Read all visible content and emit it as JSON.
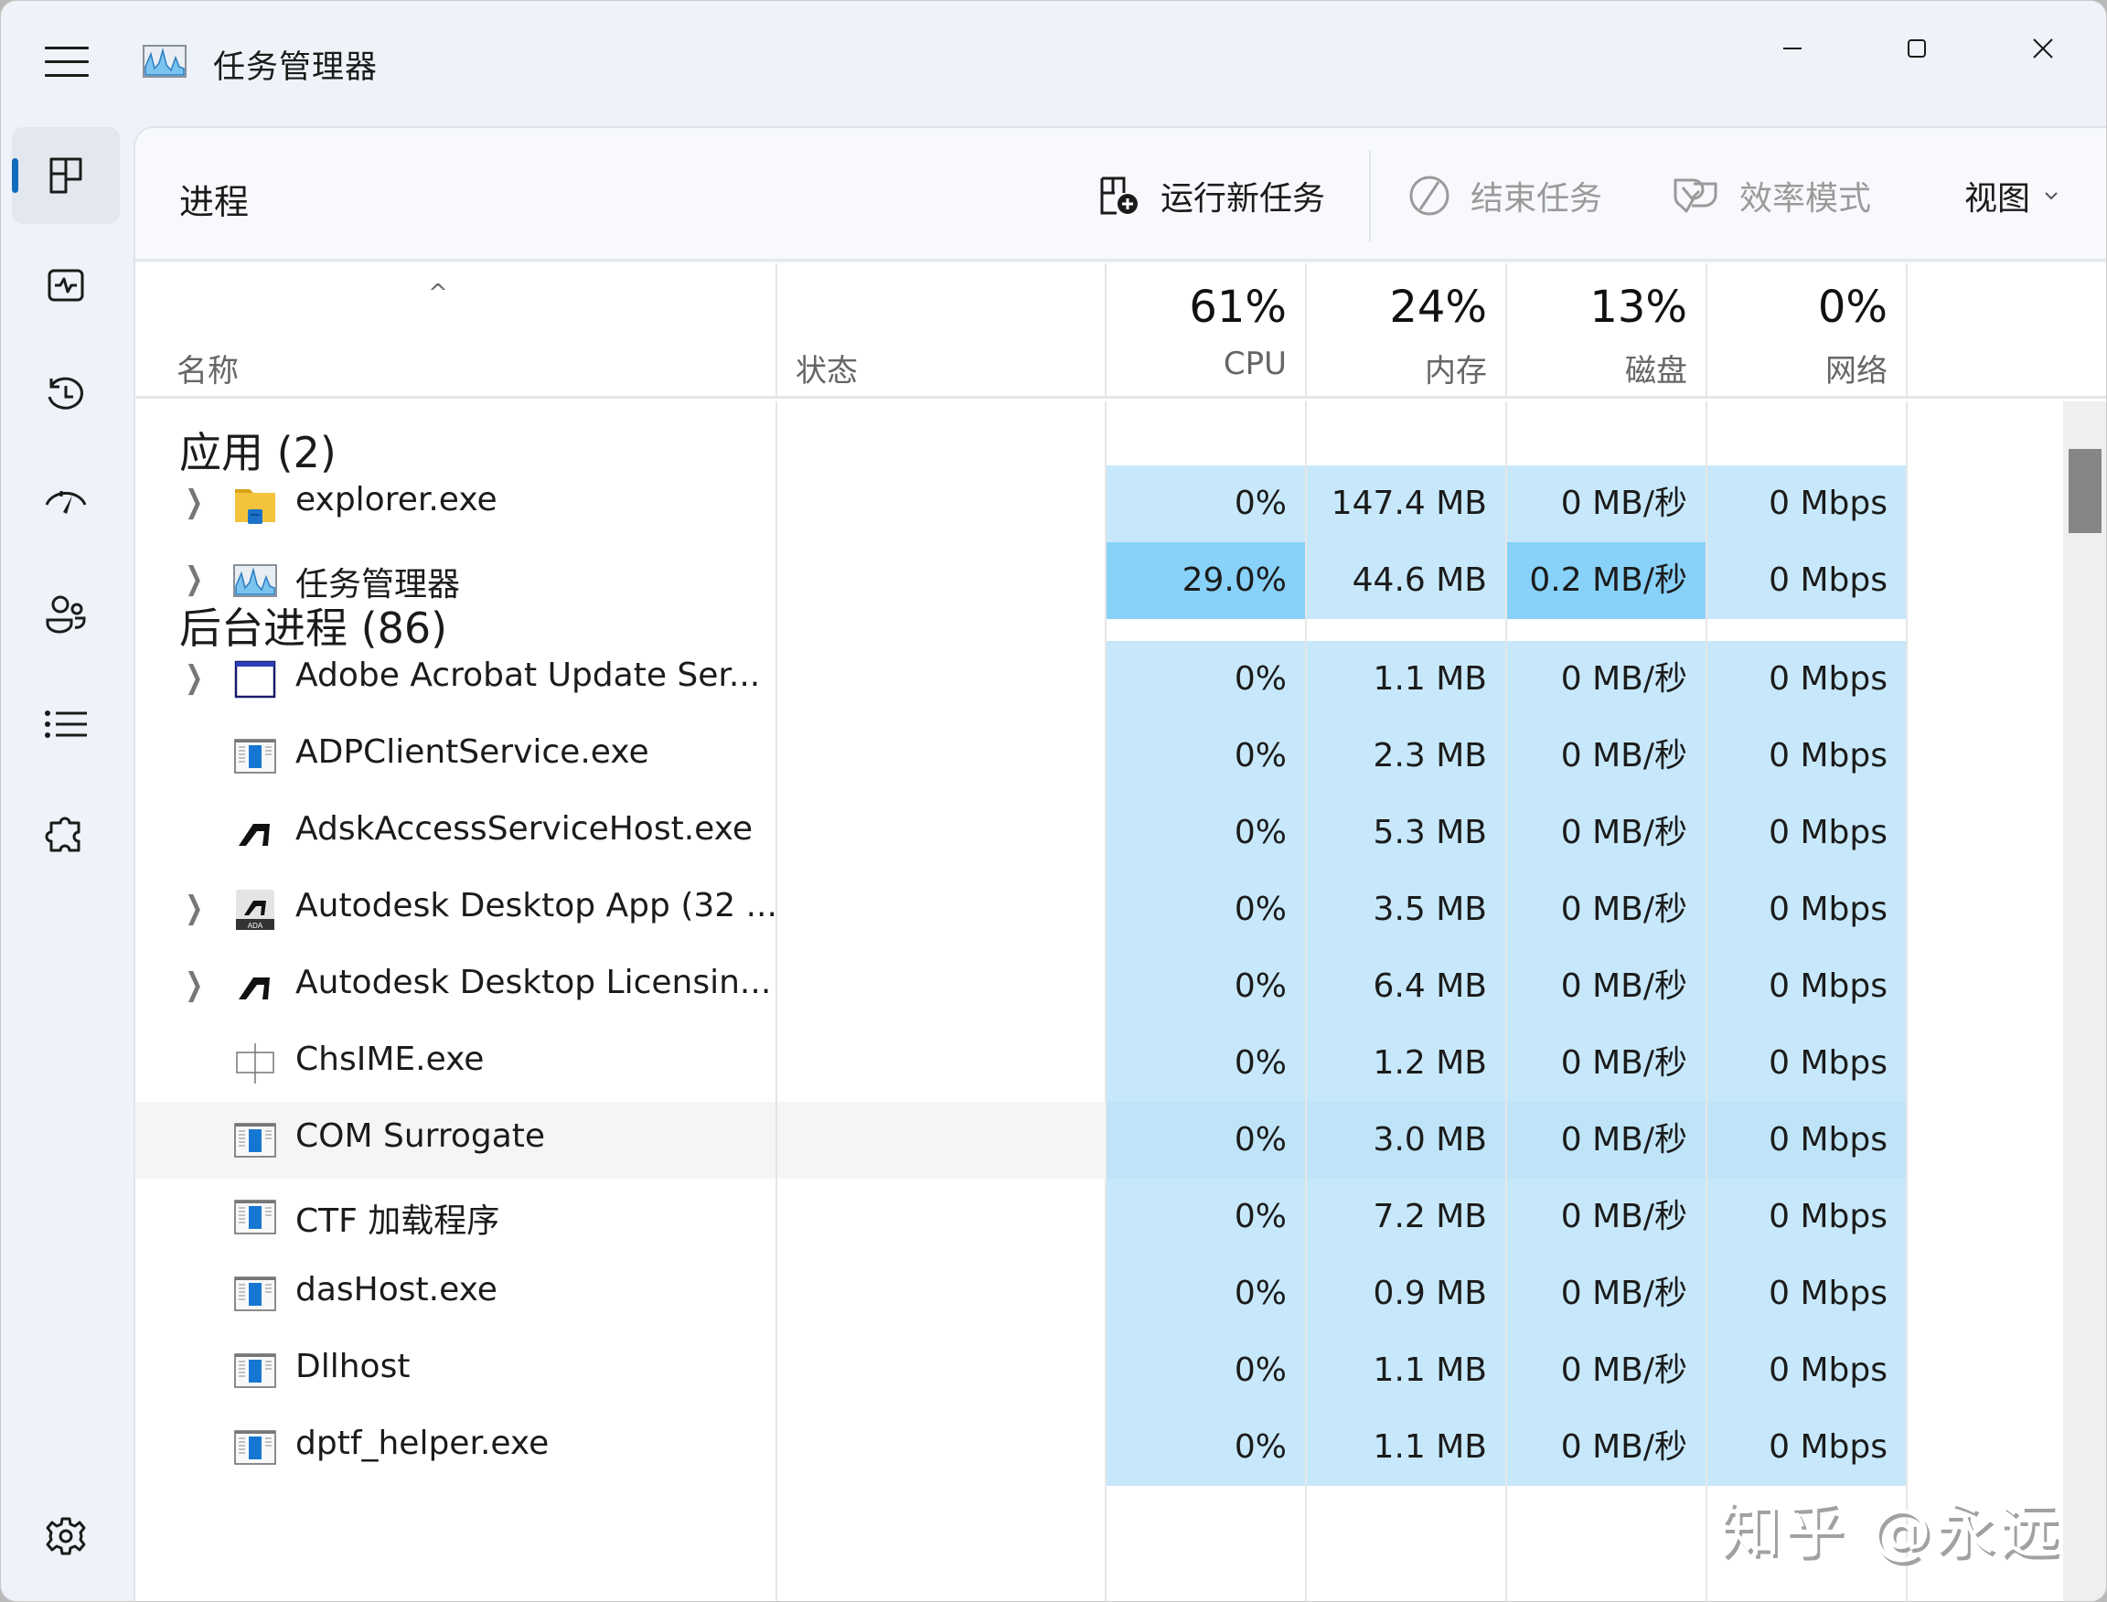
{
  "window": {
    "title": "任务管理器",
    "controls": {
      "minimize": "minimize",
      "maximize": "maximize",
      "close": "close"
    }
  },
  "sidebar": {
    "items": [
      {
        "id": "processes",
        "icon": "processes-icon",
        "active": true
      },
      {
        "id": "performance",
        "icon": "performance-icon",
        "active": false
      },
      {
        "id": "app-history",
        "icon": "history-icon",
        "active": false
      },
      {
        "id": "startup",
        "icon": "startup-gauge-icon",
        "active": false
      },
      {
        "id": "users",
        "icon": "users-icon",
        "active": false
      },
      {
        "id": "details",
        "icon": "details-list-icon",
        "active": false
      },
      {
        "id": "services",
        "icon": "services-puzzle-icon",
        "active": false
      }
    ],
    "settings_icon": "gear-icon"
  },
  "toolbar": {
    "page_title": "进程",
    "run_new_task": "运行新任务",
    "end_task": "结束任务",
    "efficiency_mode": "效率模式",
    "view": "视图"
  },
  "columns": {
    "name": "名称",
    "status": "状态",
    "cpu": {
      "pct": "61%",
      "label": "CPU"
    },
    "memory": {
      "pct": "24%",
      "label": "内存"
    },
    "disk": {
      "pct": "13%",
      "label": "磁盘"
    },
    "network": {
      "pct": "0%",
      "label": "网络"
    },
    "sort_indicator": "^"
  },
  "groups": {
    "apps": {
      "title": "应用 (2)",
      "rows": [
        {
          "name": "explorer.exe",
          "icon": "folder-icon",
          "expandable": true,
          "status": "",
          "cpu": "0%",
          "memory": "147.4 MB",
          "disk": "0 MB/秒",
          "network": "0 Mbps",
          "cpu_hot": false,
          "disk_hot": false
        },
        {
          "name": "任务管理器",
          "icon": "task-manager-icon",
          "expandable": true,
          "status": "",
          "cpu": "29.0%",
          "memory": "44.6 MB",
          "disk": "0.2 MB/秒",
          "network": "0 Mbps",
          "cpu_hot": true,
          "disk_hot": true
        }
      ]
    },
    "background": {
      "title": "后台进程 (86)",
      "rows": [
        {
          "name": "Adobe Acrobat Update Ser...",
          "icon": "window-icon",
          "expandable": true,
          "status": "",
          "cpu": "0%",
          "memory": "1.1 MB",
          "disk": "0 MB/秒",
          "network": "0 Mbps"
        },
        {
          "name": "ADPClientService.exe",
          "icon": "service-app-icon",
          "expandable": false,
          "status": "",
          "cpu": "0%",
          "memory": "2.3 MB",
          "disk": "0 MB/秒",
          "network": "0 Mbps"
        },
        {
          "name": "AdskAccessServiceHost.exe",
          "icon": "autodesk-icon",
          "expandable": false,
          "status": "",
          "cpu": "0%",
          "memory": "5.3 MB",
          "disk": "0 MB/秒",
          "network": "0 Mbps"
        },
        {
          "name": "Autodesk Desktop App (32 ...",
          "icon": "autodesk-ada-icon",
          "expandable": true,
          "status": "",
          "cpu": "0%",
          "memory": "3.5 MB",
          "disk": "0 MB/秒",
          "network": "0 Mbps"
        },
        {
          "name": "Autodesk Desktop Licensin...",
          "icon": "autodesk-icon",
          "expandable": true,
          "status": "",
          "cpu": "0%",
          "memory": "6.4 MB",
          "disk": "0 MB/秒",
          "network": "0 Mbps"
        },
        {
          "name": "ChsIME.exe",
          "icon": "ime-icon",
          "expandable": false,
          "status": "",
          "cpu": "0%",
          "memory": "1.2 MB",
          "disk": "0 MB/秒",
          "network": "0 Mbps"
        },
        {
          "name": "COM Surrogate",
          "icon": "service-app-icon",
          "expandable": false,
          "status": "",
          "cpu": "0%",
          "memory": "3.0 MB",
          "disk": "0 MB/秒",
          "network": "0 Mbps",
          "hover": true
        },
        {
          "name": "CTF 加载程序",
          "icon": "service-app-icon",
          "expandable": false,
          "status": "",
          "cpu": "0%",
          "memory": "7.2 MB",
          "disk": "0 MB/秒",
          "network": "0 Mbps"
        },
        {
          "name": "dasHost.exe",
          "icon": "service-app-icon",
          "expandable": false,
          "status": "",
          "cpu": "0%",
          "memory": "0.9 MB",
          "disk": "0 MB/秒",
          "network": "0 Mbps"
        },
        {
          "name": "Dllhost",
          "icon": "service-app-icon",
          "expandable": false,
          "status": "",
          "cpu": "0%",
          "memory": "1.1 MB",
          "disk": "0 MB/秒",
          "network": "0 Mbps"
        },
        {
          "name": "dptf_helper.exe",
          "icon": "service-app-icon",
          "expandable": false,
          "status": "",
          "cpu": "0%",
          "memory": "1.1 MB",
          "disk": "0 MB/秒",
          "network": "0 Mbps"
        }
      ]
    }
  },
  "colors": {
    "accent": "#0f6cbd",
    "heat_low": "#c7e8fa",
    "heat_high": "#88d1f9",
    "sidebar_bg": "#eef3f9"
  },
  "watermark": "知乎 @永远"
}
